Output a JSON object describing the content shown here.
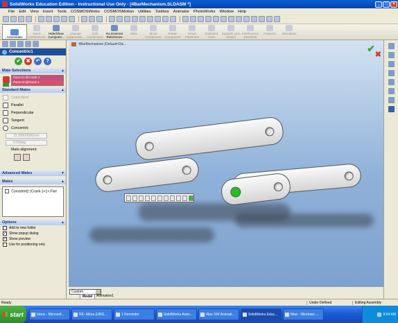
{
  "title": "SolidWorks Education Edition - Instructional Use Only - [4BarMechanism.SLDASM *]",
  "menu": [
    "File",
    "Edit",
    "View",
    "Insert",
    "Tools",
    "COSMOSWorks",
    "COSMOSMotion",
    "Utilities",
    "Toolbox",
    "Animator",
    "PhotoWorks",
    "Window",
    "Help"
  ],
  "command_manager": {
    "assemblies": "Assemblies",
    "items": [
      "Insert Components",
      "Hide/Show Compone...",
      "Change Suppressio...",
      "Edit Component",
      "No External References",
      "Mate",
      "Move Component",
      "Rotate Component",
      "Smart Fasteners",
      "Exploded View",
      "Explode Line Sketch",
      "Interference Detection",
      "Features",
      "Simulation"
    ]
  },
  "property_manager": {
    "title": "Concentric1",
    "mate_selections": {
      "header": "Mate Selections",
      "items": [
        "Face<1>@Crank-1",
        "Face<4>@Fixed-1"
      ]
    },
    "standard_mates": {
      "header": "Standard Mates",
      "items": [
        "Coincident",
        "Parallel",
        "Perpendicular",
        "Tangent",
        "Concentric"
      ],
      "distance": "22.00000000mm",
      "angle": "0.00deg",
      "alignment_label": "Mate alignment:"
    },
    "advanced_mates": {
      "header": "Advanced Mates"
    },
    "mates": {
      "header": "Mates",
      "entry": "Concident2 (Crank-1<1>,Fixe"
    },
    "options": {
      "header": "Options",
      "items": [
        {
          "label": "Add to new folder",
          "checked": false
        },
        {
          "label": "Show popup dialog",
          "checked": true
        },
        {
          "label": "Show preview",
          "checked": true
        },
        {
          "label": "Use for positioning only",
          "checked": false
        }
      ]
    }
  },
  "viewport": {
    "tree_root": "4BarMechanism (Default<Dis..."
  },
  "bottom": {
    "config": "Custom",
    "tabs": [
      "Model",
      "Animation1"
    ]
  },
  "status": {
    "left": "Ready",
    "middle": "Under Defined",
    "right": "Editing Assembly"
  },
  "taskbar": {
    "start": "start",
    "tasks": [
      "Inbox - Microsof...",
      "RE: Alhua (URG...",
      "1 Reminder",
      "SolidWorks Anim...",
      "4bar SW Animati...",
      "SolidWorks Educ...",
      "New - Windows ..."
    ],
    "clock": "9:54 AM"
  },
  "colors": {
    "accent": "#1d4f9c",
    "ok": "#3aa23a",
    "cancel": "#d23b2b",
    "selected_face": "#20c020"
  }
}
